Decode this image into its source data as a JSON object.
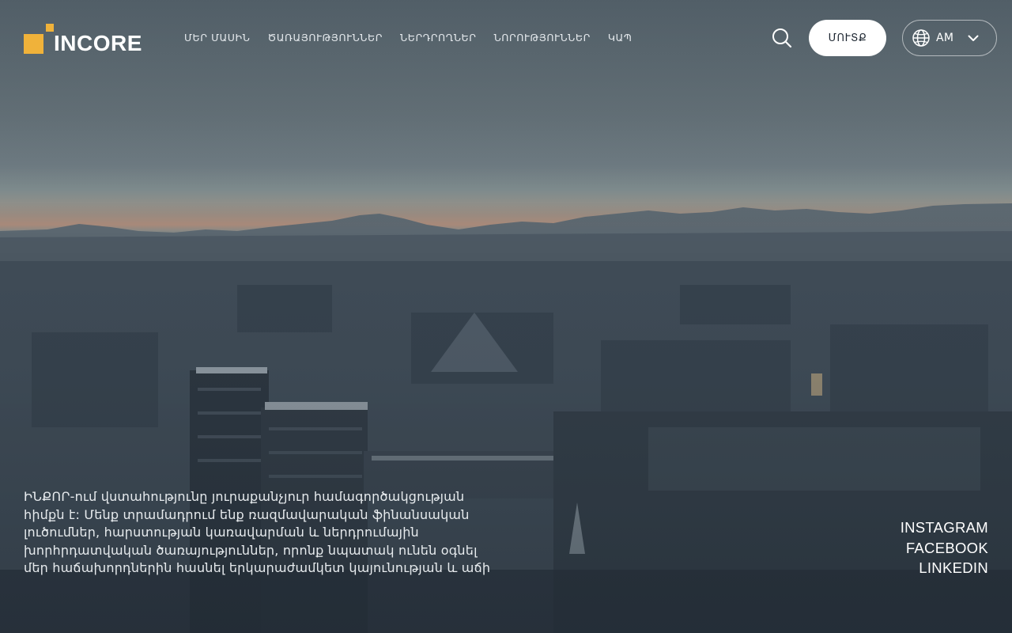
{
  "brand": {
    "name": "INCORE",
    "accent_color": "#f0b23a"
  },
  "nav": {
    "items": [
      {
        "label": "ՄԵՐ ՄԱՍԻՆ"
      },
      {
        "label": "ԾԱՌԱՅՈՒԹՅՈՒՆՆԵՐ"
      },
      {
        "label": "ՆԵՐԴՐՈՂՆԵՐ"
      },
      {
        "label": "ՆՈՐՈՒԹՅՈՒՆՆԵՐ"
      },
      {
        "label": "ԿԱՊ"
      }
    ]
  },
  "header": {
    "search_icon": "search-icon",
    "login_label": "ՄՈՒՏՔ",
    "language": {
      "code": "AM",
      "icon": "globe-icon",
      "dropdown_icon": "chevron-down-icon"
    }
  },
  "hero": {
    "intro_lines": [
      "ԻՆՔՈՐ-ում վստահությունը յուրաքանչյուր համագործակցության",
      "հիմքն է: Մենք տրամադրում ենք ռազմավարական ֆինանսական",
      "լուծումներ, հարստության կառավարման և ներդրումային",
      "խորհրդատվական ծառայություններ, որոնք նպատակ ունեն օգնել",
      "մեր հաճախորդներին հասնել երկարաժամկետ կայունության և աճի"
    ]
  },
  "social": {
    "links": [
      {
        "label": "INSTAGRAM"
      },
      {
        "label": "FACEBOOK"
      },
      {
        "label": "LINKEDIN"
      }
    ]
  }
}
